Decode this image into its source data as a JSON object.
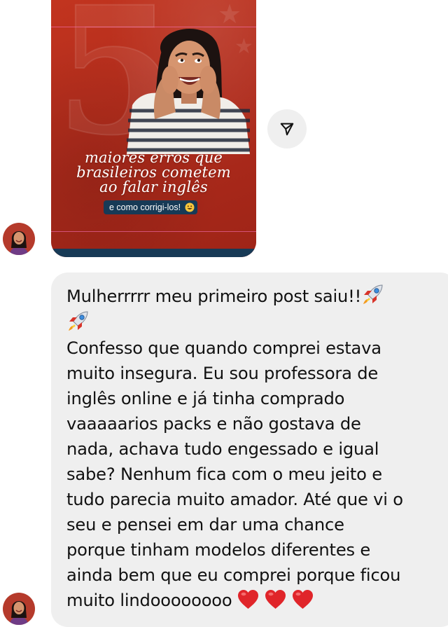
{
  "post": {
    "big_numeral": "5",
    "title_lines": [
      "maiores erros que",
      "brasileiros cometem",
      "ao falar inglês"
    ],
    "subtitle": "e como corrigi-los!",
    "subtitle_emoji": "grinning-face-emoji",
    "colors": {
      "background": "#b22d1e",
      "navy": "#173a56"
    }
  },
  "share": {
    "icon": "paper-plane-icon"
  },
  "avatars": {
    "icon": "user-avatar"
  },
  "message": {
    "line1": "Mulherrrrr meu primeiro post saiu!!",
    "line1_emojis": [
      "rocket",
      "rocket"
    ],
    "body": "Confesso que quando comprei estava\nmuito insegura. Eu sou professora de\ninglês online e já tinha comprado\nvaaaaarios packs e não gostava de\nnada, achava tudo engessado e igual\nsabe? Nenhum fica com o meu jeito e\ntudo parecia muito amador. Até que vi o\nseu e pensei em dar uma chance\nporque tinham modelos diferentes e\nainda bem que eu comprei porque ficou\n",
    "last_line": "muito lindoooooooo",
    "end_emojis": [
      "heart",
      "heart",
      "heart"
    ],
    "bubble_color": "#efefef"
  }
}
